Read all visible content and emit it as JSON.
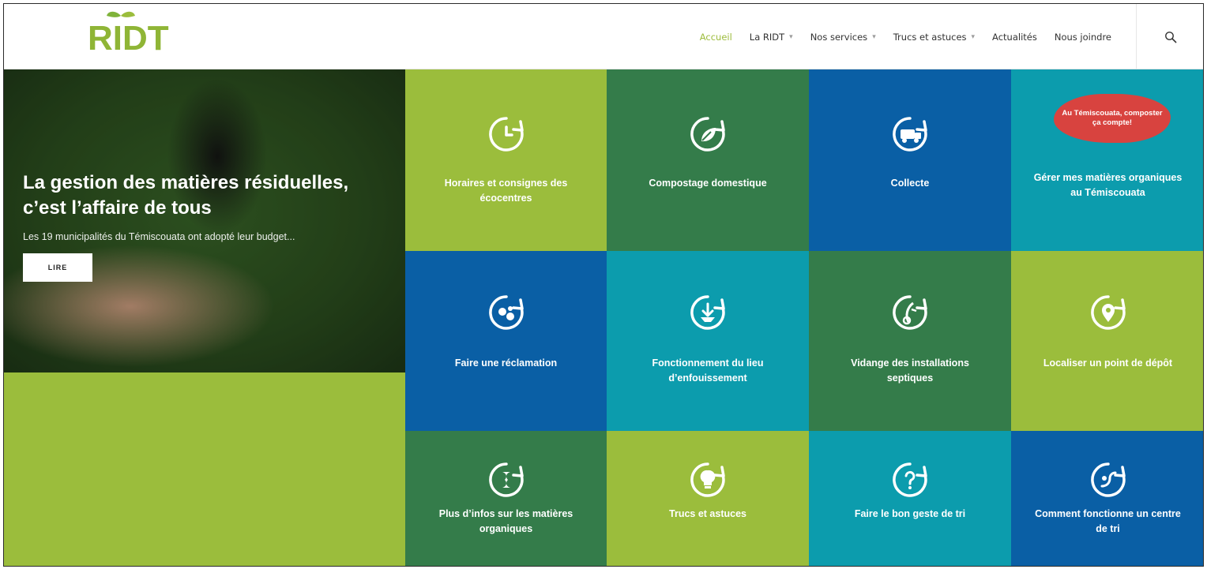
{
  "header": {
    "logo_text": "RIDT",
    "nav": [
      {
        "label": "Accueil",
        "active": true,
        "dropdown": false
      },
      {
        "label": "La RIDT",
        "active": false,
        "dropdown": true
      },
      {
        "label": "Nos services",
        "active": false,
        "dropdown": true
      },
      {
        "label": "Trucs et astuces",
        "active": false,
        "dropdown": true
      },
      {
        "label": "Actualités",
        "active": false,
        "dropdown": false
      },
      {
        "label": "Nous joindre",
        "active": false,
        "dropdown": false
      }
    ],
    "search_icon": "search-icon"
  },
  "hero": {
    "title": "La gestion des matières résiduelles, c’est l’affaire de tous",
    "subtitle": "Les 19 municipalités du Témiscouata ont adopté leur budget...",
    "button_label": "LIRE"
  },
  "tiles": [
    {
      "label": "Horaires et consignes des écocentres",
      "color": "#9bbd3c",
      "icon": "clock-icon"
    },
    {
      "label": "Compostage domestique",
      "color": "#347c4a",
      "icon": "leaf-icon"
    },
    {
      "label": "Collecte",
      "color": "#0a5fa5",
      "icon": "truck-icon"
    },
    {
      "label": "Gérer mes matières organiques au Témiscouata",
      "color": "#0c9cad",
      "icon": "badge",
      "badge_text": "Au Témiscouata, composter ça compte!"
    },
    {
      "label": "Faire une réclamation",
      "color": "#0a5fa5",
      "icon": "complaint-icon"
    },
    {
      "label": "Fonctionnement du lieu d’enfouissement",
      "color": "#0c9cad",
      "icon": "download-icon"
    },
    {
      "label": "Vidange des installations septiques",
      "color": "#347c4a",
      "icon": "septic-icon"
    },
    {
      "label": "Localiser un point de dépôt",
      "color": "#9bbd3c",
      "icon": "map-pin-icon"
    },
    {
      "label": "Plus d’infos sur les matières organiques",
      "color": "#347c4a",
      "icon": "apple-core-icon"
    },
    {
      "label": "Trucs et astuces",
      "color": "#9bbd3c",
      "icon": "lightbulb-icon"
    },
    {
      "label": "Faire le bon geste de tri",
      "color": "#0c9cad",
      "icon": "question-icon"
    },
    {
      "label": "Comment fonctionne un centre de tri",
      "color": "#0a5fa5",
      "icon": "sort-center-icon"
    }
  ]
}
